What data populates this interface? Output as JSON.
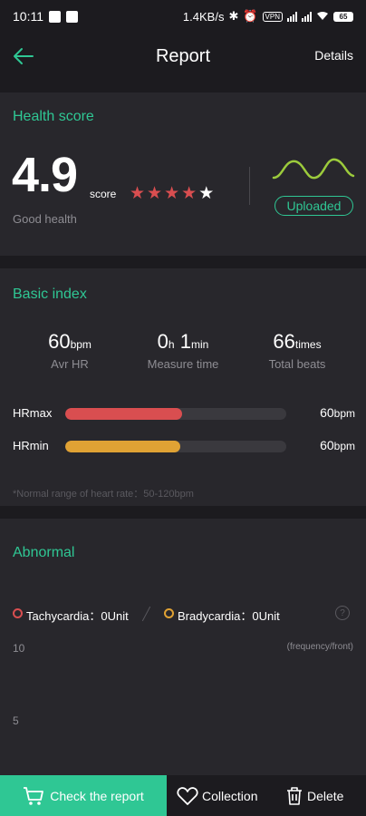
{
  "status_bar": {
    "time": "10:11",
    "network_speed": "1.4KB/s",
    "vpn_tag": "VPN",
    "battery": "65"
  },
  "header": {
    "title": "Report",
    "details_label": "Details"
  },
  "health_score": {
    "title": "Health score",
    "score": "4.9",
    "score_unit": "score",
    "stars_filled": 4,
    "stars_total": 5,
    "status": "Good health",
    "badge": "Uploaded"
  },
  "basic_index": {
    "title": "Basic index",
    "avr_hr": {
      "value": "60",
      "unit": "bpm",
      "label": "Avr HR"
    },
    "measure_time": {
      "hours": "0",
      "hours_unit": "h",
      "minutes": "1",
      "minutes_unit": "min",
      "label": "Measure time"
    },
    "total_beats": {
      "value": "66",
      "unit": "times",
      "label": "Total beats"
    },
    "hrmax": {
      "label": "HRmax",
      "value": "60",
      "unit": "bpm",
      "fill_fraction": 0.53
    },
    "hrmin": {
      "label": "HRmin",
      "value": "60",
      "unit": "bpm",
      "fill_fraction": 0.52
    },
    "note": "*Normal range of heart rate：50-120bpm"
  },
  "abnormal": {
    "title": "Abnormal",
    "tachycardia": "Tachycardia：0Unit",
    "bradycardia": "Bradycardia：0Unit",
    "help": "?",
    "y_ticks": [
      "10",
      "5"
    ],
    "unit_label": "(frequency/front)"
  },
  "bottom_bar": {
    "check_report": "Check the report",
    "collection": "Collection",
    "delete": "Delete"
  },
  "colors": {
    "accent": "#2fc794",
    "background": "#1c1b1f",
    "card": "#28272c",
    "hrmax": "#d94e50",
    "hrmin": "#e0a234",
    "star_filled": "#d94e50"
  }
}
